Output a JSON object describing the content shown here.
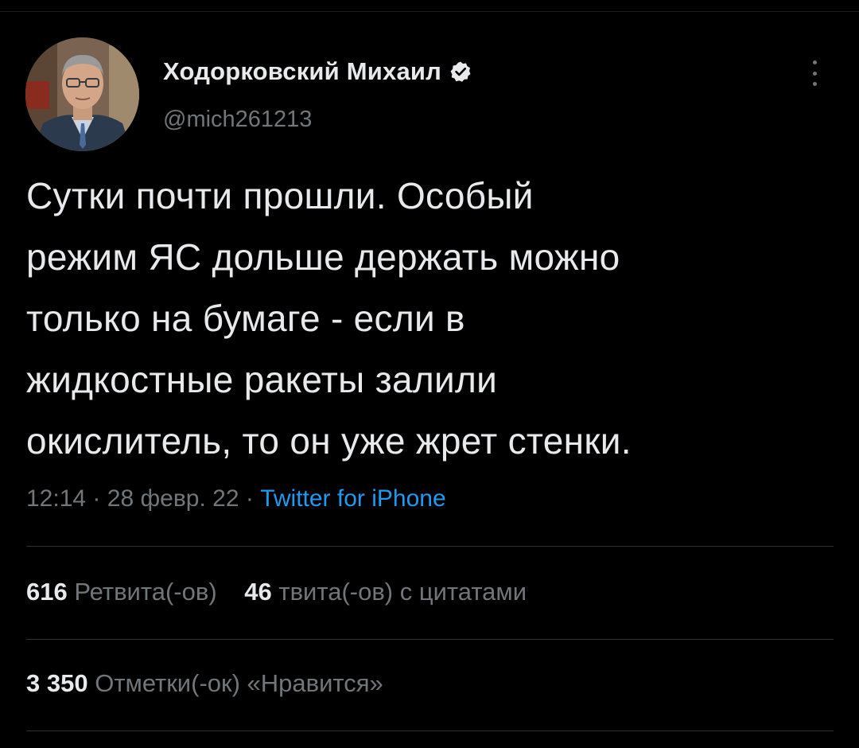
{
  "author": {
    "display_name": "Ходорковский Михаил",
    "handle": "@mich261213",
    "verified_icon": "verified-badge-icon",
    "avatar": "author-avatar-photo"
  },
  "tweet": {
    "lines": [
      "Сутки почти прошли. Особый",
      "режим ЯС дольше держать можно",
      "только на бумаге - если в",
      "жидкостные ракеты залили",
      "окислитель, то он уже жрет стенки."
    ],
    "time": "12:14",
    "date": "28 февр. 22",
    "separator": "·",
    "source": "Twitter for iPhone"
  },
  "stats": {
    "retweets_count": "616",
    "retweets_label": "Ретвита(-ов)",
    "quotes_count": "46",
    "quotes_label": "твита(-ов) с цитатами",
    "likes_count": "3 350",
    "likes_label": "Отметки(-ок) «Нравится»"
  },
  "colors": {
    "background": "#000000",
    "primary_text": "#e7e9ea",
    "secondary_text": "#71767b",
    "link": "#1d9bf0",
    "divider": "#2f3336"
  }
}
